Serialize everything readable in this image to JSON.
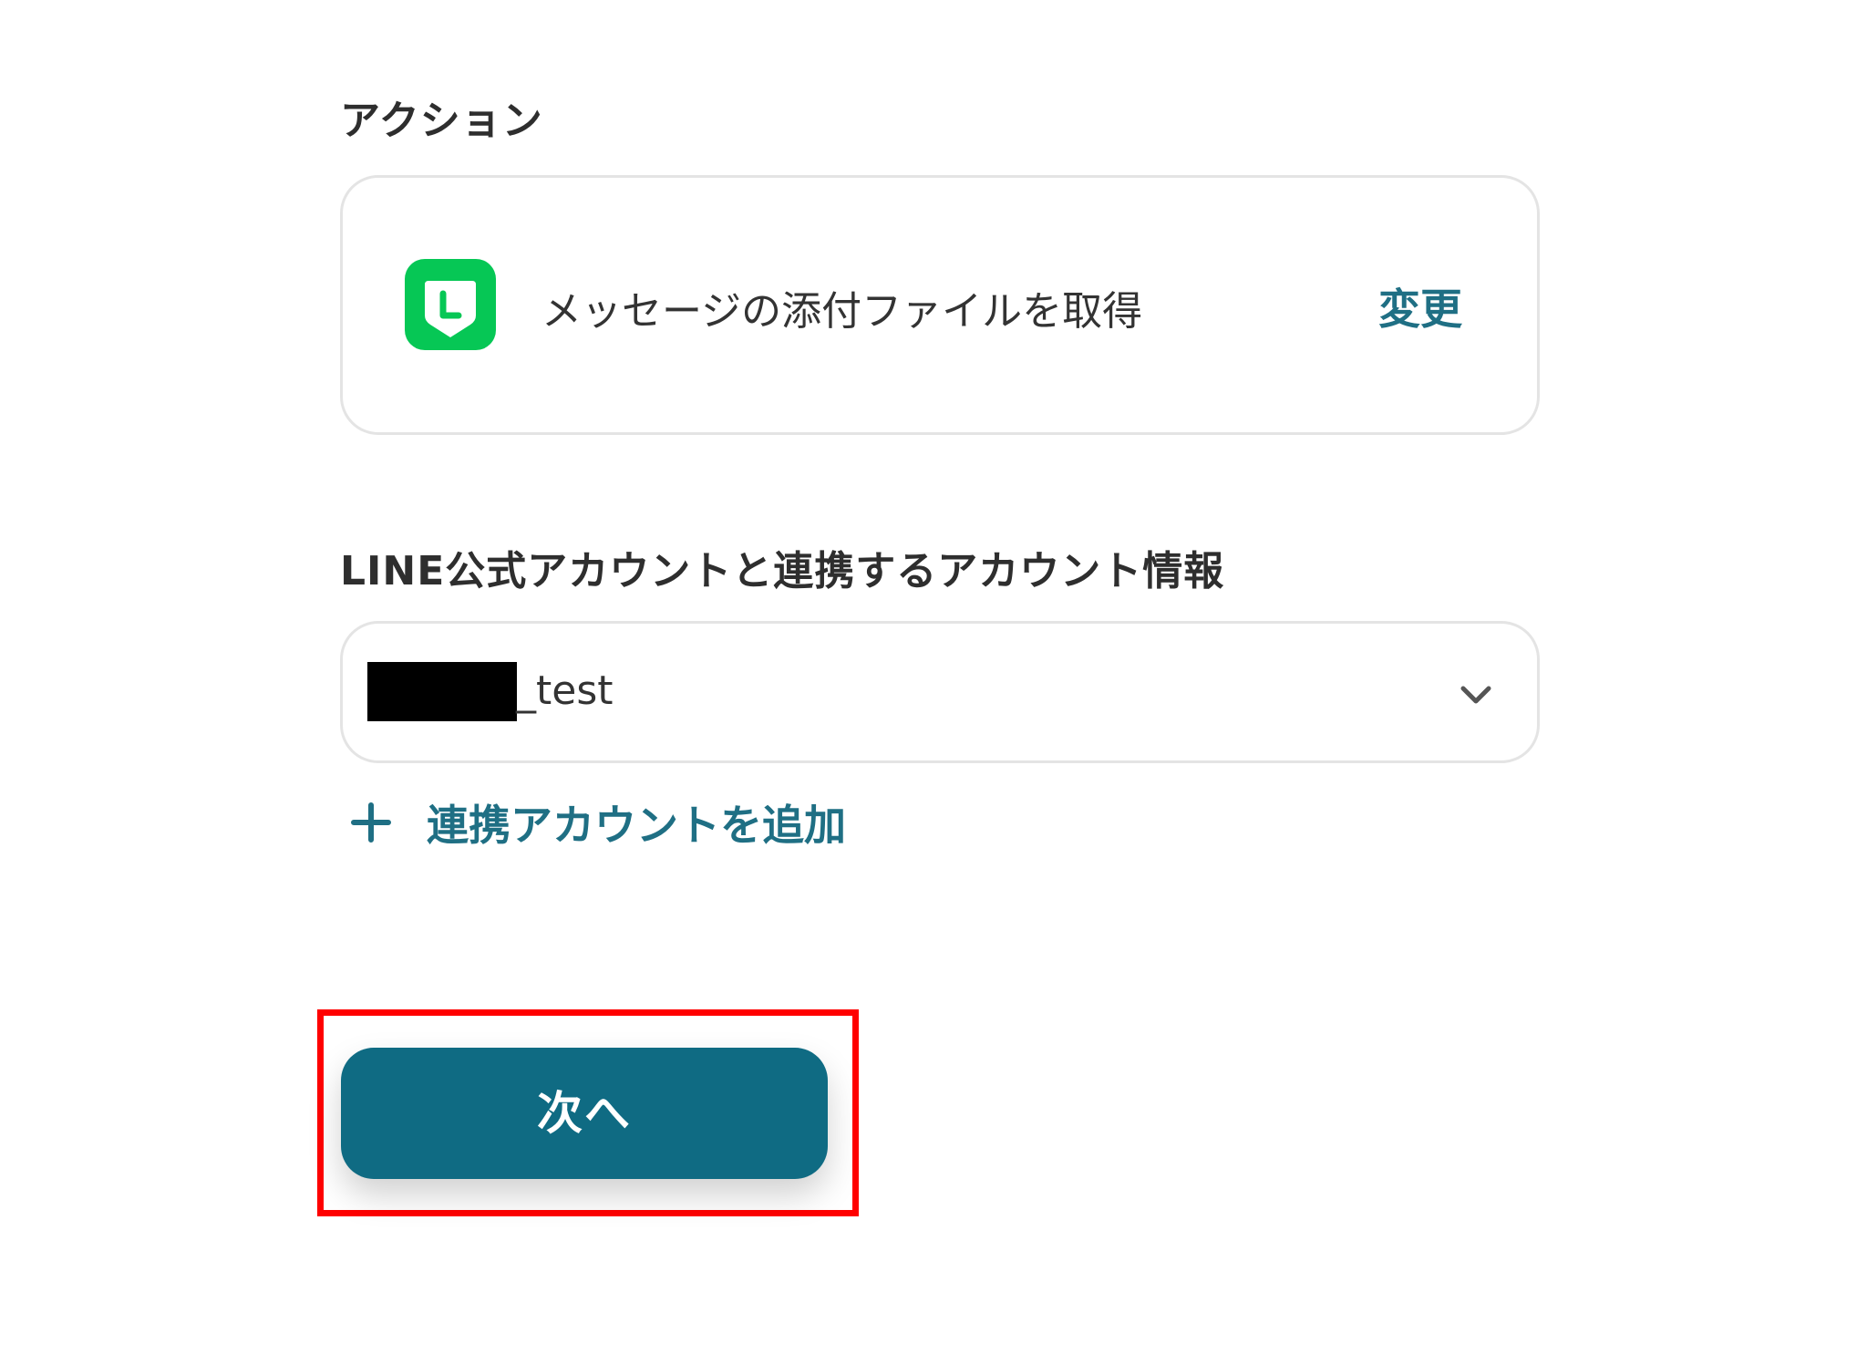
{
  "action_section": {
    "label": "アクション",
    "app_icon": "line-app-icon",
    "action_name": "メッセージの添付ファイルを取得",
    "change_label": "変更"
  },
  "account_section": {
    "label": "LINE公式アカウントと連携するアカウント情報",
    "selected_value": "_test",
    "chevron_icon": "chevron-down-icon",
    "add_icon": "plus-icon",
    "add_label": "連携アカウントを追加"
  },
  "footer": {
    "next_label": "次へ"
  },
  "colors": {
    "accent": "#1f6f84",
    "button": "#0f6b83",
    "line_green": "#06c755",
    "highlight": "#ff0000"
  }
}
